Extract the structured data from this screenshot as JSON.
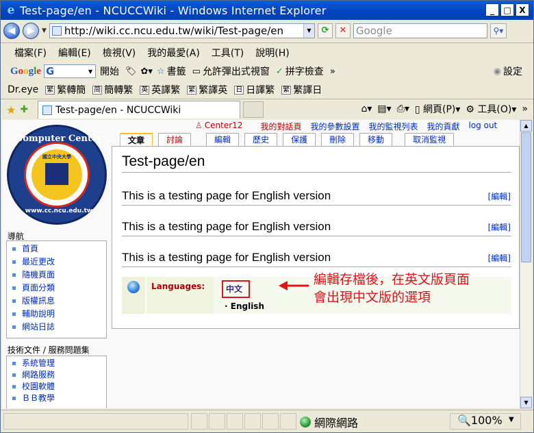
{
  "window": {
    "title": "Test-page/en - NCUCCWiki - Windows Internet Explorer",
    "buttons": [
      "_",
      "□",
      "X"
    ]
  },
  "address_bar": {
    "url": "http://wiki.cc.ncu.edu.tw/wiki/Test-page/en",
    "search_placeholder": "Google"
  },
  "menu": [
    "檔案(F)",
    "編輯(E)",
    "檢視(V)",
    "我的最愛(A)",
    "工具(T)",
    "說明(H)"
  ],
  "google_toolbar": {
    "logo": "Google",
    "combo": "G",
    "start_label": "開始",
    "bookmarks_label": "書籤",
    "popup_label": "允許彈出式視窗",
    "spell_label": "拼字檢查",
    "settings_label": "設定"
  },
  "dreye_toolbar": {
    "name": "Dr.eye",
    "items": [
      {
        "icon": "繁",
        "label": "繁轉簡"
      },
      {
        "icon": "简",
        "label": "簡轉繁"
      },
      {
        "icon": "英",
        "label": "英譯繁"
      },
      {
        "icon": "繁",
        "label": "繁譯英"
      },
      {
        "icon": "日",
        "label": "日譯繁"
      },
      {
        "icon": "繁",
        "label": "繁譯日"
      }
    ]
  },
  "tabs": {
    "active_title": "Test-page/en - NCUCCWiki",
    "page_label": "網頁(P)",
    "tools_label": "工具(O)"
  },
  "logo": {
    "top_text": "Computer Center",
    "bottom_text": "www.cc.ncu.edu.tw",
    "badge_text": "國立中央大學"
  },
  "sidebar": {
    "nav_heading": "導航",
    "nav_items": [
      "首頁",
      "最近更改",
      "隨機頁面",
      "頁面分類",
      "版權訊息",
      "輔助說明",
      "網站日誌"
    ],
    "tech_heading": "技術文件 / 服務問題集",
    "tech_items": [
      "系統管理",
      "網路服務",
      "校園軟體",
      "ＢＢ教學"
    ]
  },
  "personal": {
    "user": "Center12",
    "talk": "我的對話頁",
    "prefs": "我的參數設置",
    "watchlist": "我的監視列表",
    "contribs": "我的貢獻",
    "logout": "log out"
  },
  "content_tabs": [
    "文章",
    "討論",
    "編輯",
    "歷史",
    "保護",
    "刪除",
    "移動",
    "取消監視"
  ],
  "page": {
    "title": "Test-page/en",
    "sections": [
      "This is a testing page for English version",
      "This is a testing page for English version",
      "This is a testing page for English version"
    ],
    "edit_link": "[編輯]"
  },
  "languages": {
    "label": "Languages:",
    "zh": "中文",
    "en": "English"
  },
  "annotation": {
    "line1": "編輯存檔後，在英文版頁面",
    "line2": "會出現中文版的選項"
  },
  "status": {
    "zone": "網際網路",
    "zoom": "100%"
  },
  "colors": {
    "title_bar": "#0a5fd8",
    "link": "#002bb8",
    "new_link": "#ba0000",
    "annotation": "#e2121a",
    "selected_tab_border": "#fabd23"
  }
}
